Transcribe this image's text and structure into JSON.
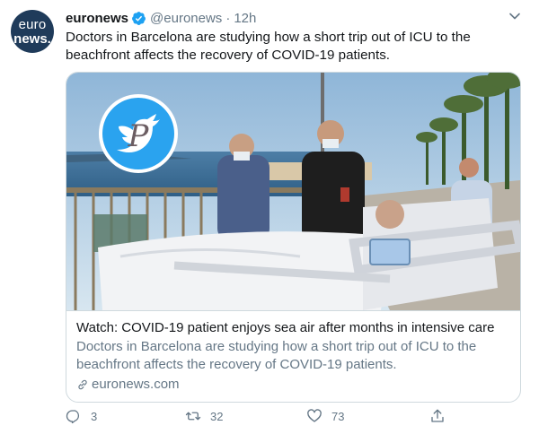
{
  "author": {
    "avatar_logo_top": "euro",
    "avatar_logo_bottom": "news.",
    "display_name": "euronews",
    "verified": true,
    "handle": "@euronews",
    "separator": "·",
    "time": "12h"
  },
  "tweet": {
    "text": "Doctors in Barcelona are studying how a short trip out of ICU to the beachfront affects the recovery of COVID-19 patients."
  },
  "card": {
    "image_icon": "photo-of-patient-on-beachfront",
    "watermark_icon": "twitter-bird-watermark",
    "watermark_letter": "P",
    "title": "Watch: COVID-19 patient enjoys sea air after months in intensive care",
    "description": "Doctors in Barcelona are studying how a short trip out of ICU to the beachfront affects the recovery of COVID-19 patients.",
    "link_icon": "link-icon",
    "domain": "euronews.com"
  },
  "actions": {
    "reply": {
      "icon": "reply-icon",
      "count": "3"
    },
    "retweet": {
      "icon": "retweet-icon",
      "count": "32"
    },
    "like": {
      "icon": "heart-icon",
      "count": "73"
    },
    "share": {
      "icon": "share-icon"
    }
  },
  "colors": {
    "brand_avatar": "#1f3b5a",
    "verified": "#1da1f2",
    "secondary_text": "#657786",
    "border": "#cfd9de"
  }
}
